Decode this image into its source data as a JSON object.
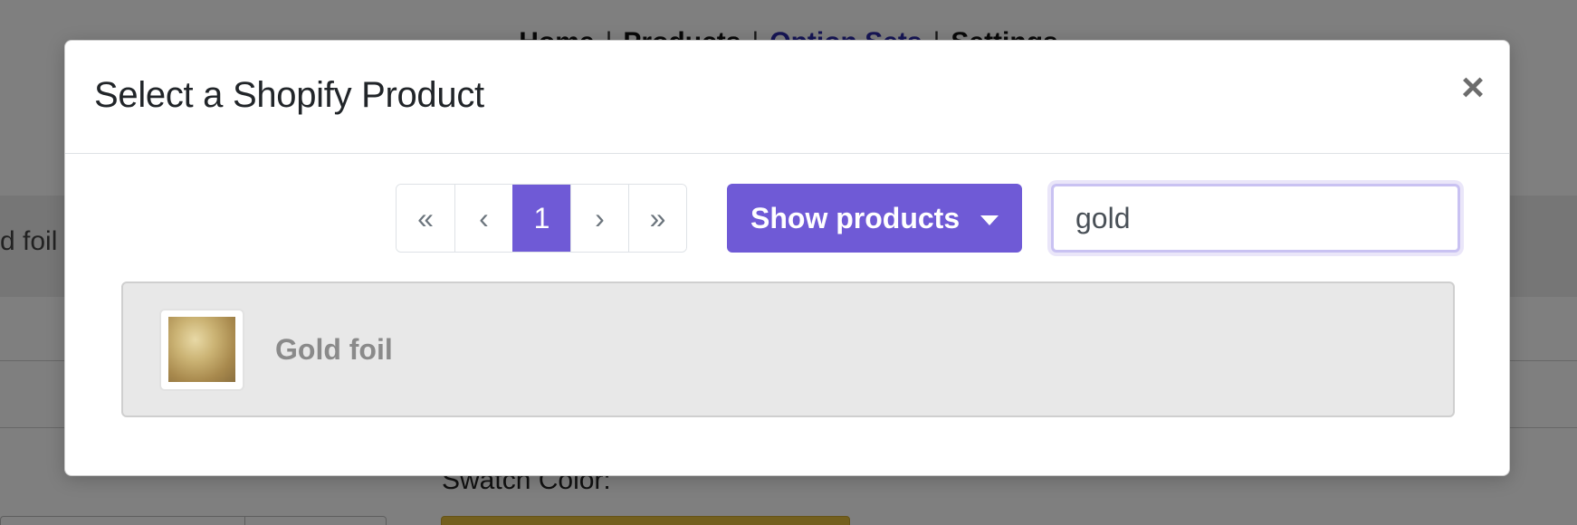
{
  "background": {
    "nav": [
      "Home",
      "Products",
      "Option Sets",
      "Settings"
    ],
    "band_text": "d foil",
    "swatch_label": "Swatch Color:"
  },
  "modal": {
    "title": "Select a Shopify Product",
    "close_symbol": "×"
  },
  "pagination": {
    "first": "«",
    "prev": "‹",
    "current": "1",
    "next": "›",
    "last": "»"
  },
  "filter": {
    "show_button_label": "Show products"
  },
  "search": {
    "value": "gold"
  },
  "results": [
    {
      "name": "Gold foil",
      "thumbnail": "gold-foil-image"
    }
  ],
  "colors": {
    "accent": "#6f5ad6",
    "swatch": "#e6bf3c"
  }
}
